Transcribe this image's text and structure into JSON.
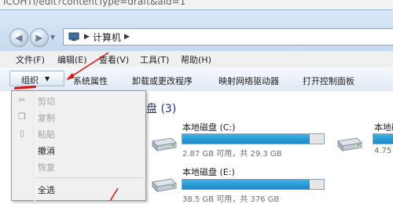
{
  "url_fragment": "ICOHTI/edit?contentType=draft&aid=1",
  "address": {
    "crumb": "计算机"
  },
  "menu": [
    "文件(F)",
    "编辑(E)",
    "查看(V)",
    "工具(T)",
    "帮助(H)"
  ],
  "commands": {
    "organize": "组织",
    "items": [
      "系统属性",
      "卸载或更改程序",
      "映射网络驱动器",
      "打开控制面板"
    ]
  },
  "section_header": "盘 (3)",
  "drives": [
    {
      "name": "本地磁盘 (C:)",
      "info": "2.87 GB 可用，共 29.3 GB",
      "used_fraction": 0.9
    },
    {
      "name": "本地磁盘 (E:)",
      "info": "38.5 GB 可用，共 376 GB",
      "used_fraction": 0.9
    },
    {
      "name": "本地磁",
      "info": "4.75",
      "used_fraction": 0.9
    }
  ],
  "dropdown": {
    "items": [
      {
        "label": "剪切",
        "enabled": false,
        "icon": "scissors-icon"
      },
      {
        "label": "复制",
        "enabled": false,
        "icon": "copy-icon"
      },
      {
        "label": "粘贴",
        "enabled": false,
        "icon": "paste-icon"
      },
      {
        "label": "撤消",
        "enabled": true
      },
      {
        "label": "恢复",
        "enabled": false
      },
      {
        "label": "全选",
        "enabled": true
      }
    ]
  },
  "colors": {
    "annotation_red": "#e01010",
    "section_header": "#1e3287",
    "bar_fill": "#1e86c4"
  }
}
